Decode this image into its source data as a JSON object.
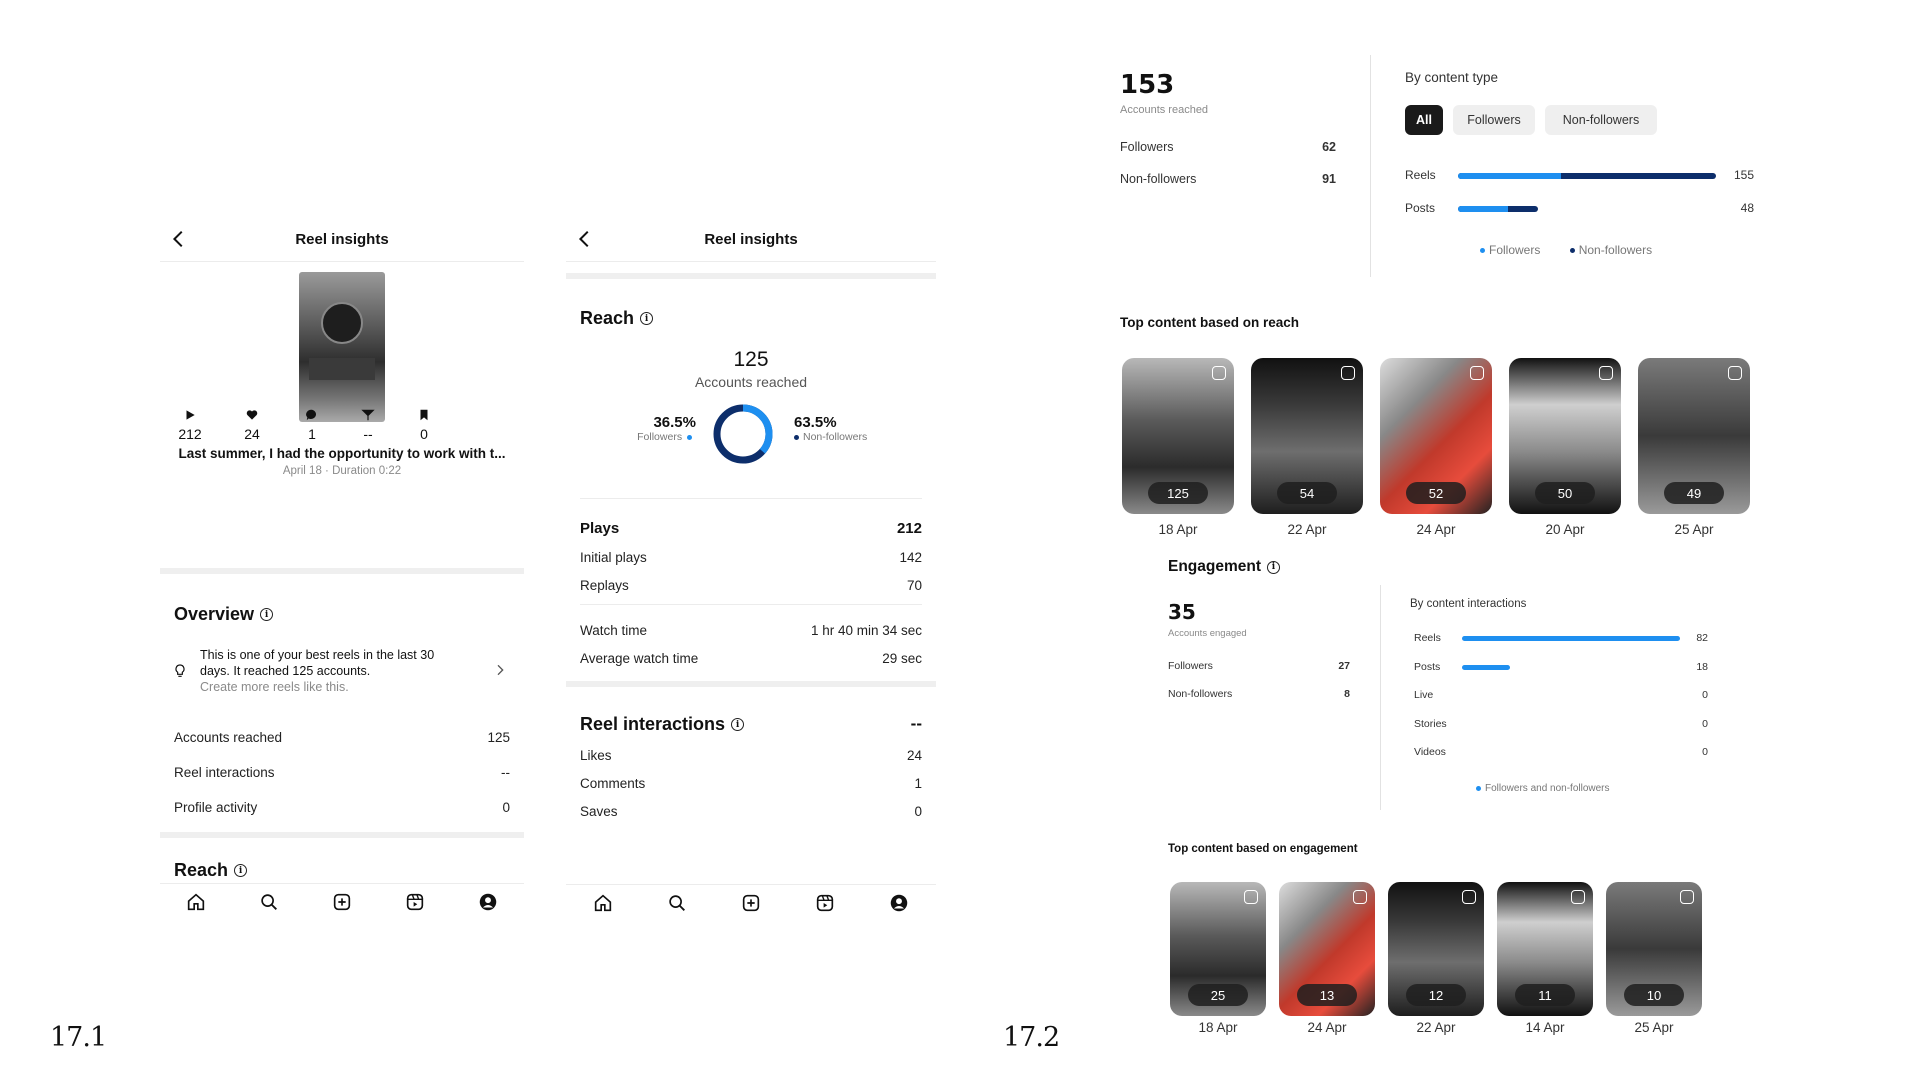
{
  "labels": {
    "left": "17.1",
    "right": "17.2"
  },
  "colors": {
    "accent": "#1e8ff0",
    "dark_blue": "#0d2e6b",
    "pill_active": "#1a1a1a",
    "pill_idle": "#efefef"
  },
  "panel1": {
    "header_title": "Reel insights",
    "caption": "Last summer, I had the opportunity to work with t...",
    "meta": "April 18 · Duration 0:22",
    "stats": [
      {
        "icon": "play-icon",
        "value": "212"
      },
      {
        "icon": "heart-icon",
        "value": "24"
      },
      {
        "icon": "comment-icon",
        "value": "1"
      },
      {
        "icon": "share-icon",
        "value": "--"
      },
      {
        "icon": "bookmark-icon",
        "value": "0"
      }
    ],
    "overview_title": "Overview",
    "tip_line1": "This is one of your best reels in the last 30",
    "tip_line2": "days. It reached 125 accounts.",
    "tip_line3": "Create more reels like this.",
    "rows": [
      {
        "label": "Accounts reached",
        "value": "125"
      },
      {
        "label": "Reel interactions",
        "value": "--"
      },
      {
        "label": "Profile activity",
        "value": "0"
      }
    ],
    "reach_title": "Reach",
    "nav": [
      "home-icon",
      "search-icon",
      "create-icon",
      "reels-icon",
      "profile-icon"
    ]
  },
  "panel2": {
    "header_title": "Reel insights",
    "reach_title": "Reach",
    "accounts_reached": "125",
    "accounts_reached_label": "Accounts reached",
    "followers_pct": "36.5%",
    "followers_label": "Followers",
    "followers_fraction": 0.365,
    "nonfollowers_pct": "63.5%",
    "nonfollowers_label": "Non-followers",
    "plays": {
      "label": "Plays",
      "value": "212"
    },
    "plays_rows": [
      {
        "label": "Initial plays",
        "value": "142"
      },
      {
        "label": "Replays",
        "value": "70"
      }
    ],
    "watch_rows": [
      {
        "label": "Watch time",
        "value": "1 hr 40 min 34 sec"
      },
      {
        "label": "Average watch time",
        "value": "29 sec"
      }
    ],
    "interactions": {
      "label": "Reel interactions",
      "value": "--"
    },
    "interaction_rows": [
      {
        "label": "Likes",
        "value": "24"
      },
      {
        "label": "Comments",
        "value": "1"
      },
      {
        "label": "Saves",
        "value": "0"
      }
    ]
  },
  "dash": {
    "reach_value": "153",
    "reach_label": "Accounts reached",
    "reach_rows": [
      {
        "label": "Followers",
        "value": "62"
      },
      {
        "label": "Non-followers",
        "value": "91"
      }
    ],
    "by_content_type": "By content type",
    "pills": [
      "All",
      "Followers",
      "Non-followers"
    ],
    "type_bars": [
      {
        "label": "Reels",
        "value": "155",
        "total": 155,
        "followers": 62
      },
      {
        "label": "Posts",
        "value": "48",
        "total": 48,
        "followers": 30
      }
    ],
    "legend": [
      "Followers",
      "Non-followers"
    ],
    "top_reach_title": "Top content based on reach",
    "top_reach": [
      {
        "value": "125",
        "date": "18 Apr"
      },
      {
        "value": "54",
        "date": "22 Apr"
      },
      {
        "value": "52",
        "date": "24 Apr"
      },
      {
        "value": "50",
        "date": "20 Apr"
      },
      {
        "value": "49",
        "date": "25 Apr"
      }
    ],
    "engagement_title": "Engagement",
    "engaged_value": "35",
    "engaged_label": "Accounts engaged",
    "engaged_rows": [
      {
        "label": "Followers",
        "value": "27"
      },
      {
        "label": "Non-followers",
        "value": "8"
      }
    ],
    "by_interactions": "By content interactions",
    "interaction_bars": [
      {
        "label": "Reels",
        "value": "82",
        "n": 82
      },
      {
        "label": "Posts",
        "value": "18",
        "n": 18
      },
      {
        "label": "Live",
        "value": "0",
        "n": 0
      },
      {
        "label": "Stories",
        "value": "0",
        "n": 0
      },
      {
        "label": "Videos",
        "value": "0",
        "n": 0
      }
    ],
    "interactions_legend": "Followers and non-followers",
    "top_engagement_title": "Top content based on engagement",
    "top_engagement": [
      {
        "value": "25",
        "date": "18 Apr"
      },
      {
        "value": "13",
        "date": "24 Apr"
      },
      {
        "value": "12",
        "date": "22 Apr"
      },
      {
        "value": "11",
        "date": "14 Apr"
      },
      {
        "value": "10",
        "date": "25 Apr"
      }
    ]
  }
}
